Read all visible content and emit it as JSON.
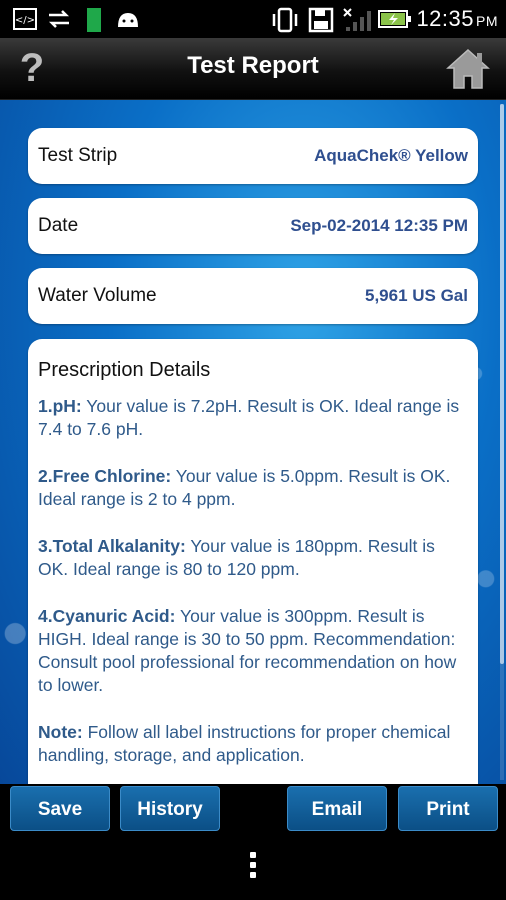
{
  "status_bar": {
    "time": "12:35",
    "ampm": "PM",
    "icons": [
      "code-icon",
      "sync-icon",
      "battery-widget-icon",
      "android-icon",
      "vibrate-icon",
      "save-icon",
      "no-signal-icon",
      "battery-charging-icon"
    ]
  },
  "header": {
    "title": "Test Report",
    "help_label": "?",
    "home_icon": "home-icon"
  },
  "report": {
    "test_strip": {
      "label": "Test Strip",
      "value": "AquaChek® Yellow"
    },
    "date": {
      "label": "Date",
      "value": "Sep-02-2014 12:35 PM"
    },
    "water_volume": {
      "label": "Water Volume",
      "value": "5,961 US Gal"
    }
  },
  "prescription": {
    "title": "Prescription Details",
    "items": [
      {
        "heading": "1.pH:",
        "text": " Your value is 7.2pH. Result is OK. Ideal range is 7.4 to 7.6 pH."
      },
      {
        "heading": "2.Free Chlorine:",
        "text": " Your value is 5.0ppm. Result is OK. Ideal range is 2 to 4 ppm."
      },
      {
        "heading": "3.Total Alkalanity:",
        "text": " Your value is 180ppm. Result is OK. Ideal range is 80 to 120 ppm."
      },
      {
        "heading": "4.Cyanuric Acid:",
        "text": " Your value is 300ppm. Result is HIGH. Ideal range is 30 to 50 ppm. Recommendation: Consult pool professional for recommendation on how to lower."
      },
      {
        "heading": "Note:",
        "text": " Follow all label instructions for proper chemical handling, storage, and application."
      }
    ]
  },
  "buttons": {
    "save": "Save",
    "history": "History",
    "email": "Email",
    "print": "Print"
  },
  "colors": {
    "accent_button": "#0b4f86",
    "value_text": "#2f4f8f"
  }
}
